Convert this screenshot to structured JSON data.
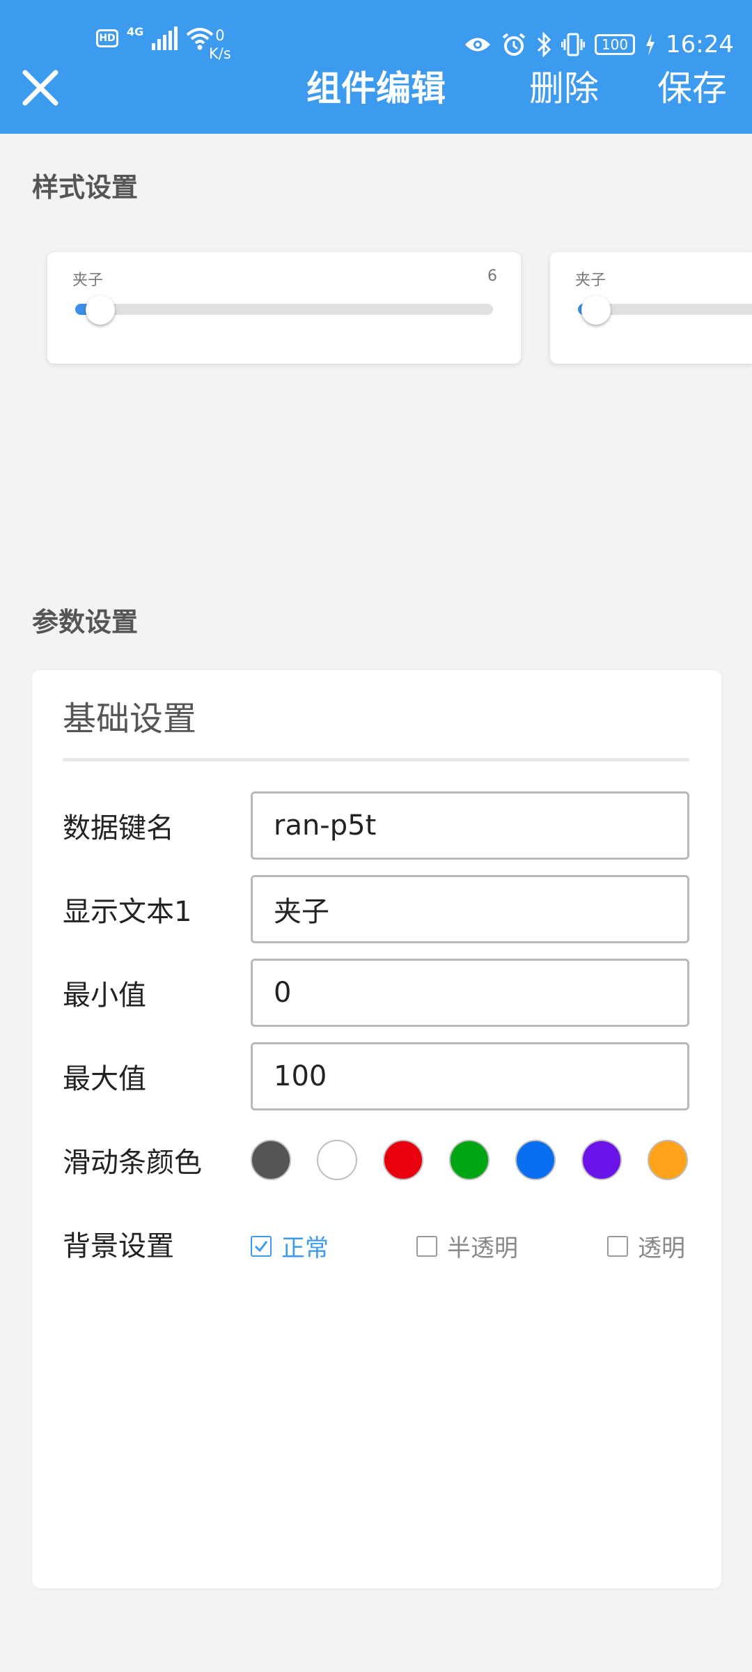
{
  "status_bar": {
    "hd": "HD",
    "network": "4G",
    "speed_value": "0",
    "speed_unit": "K/s",
    "battery": "100",
    "time": "16:24"
  },
  "header": {
    "title": "组件编辑",
    "delete_label": "删除",
    "save_label": "保存",
    "bg_color": "#3c9aef"
  },
  "style_section": {
    "title": "样式设置",
    "sliders": [
      {
        "label": "夹子",
        "value": "6",
        "level": 0.06
      },
      {
        "label": "夹子",
        "value": "",
        "level": 0.06
      }
    ]
  },
  "param_section": {
    "title": "参数设置",
    "card_title": "基础设置",
    "fields": [
      {
        "label": "数据键名",
        "value": "ran-p5t"
      },
      {
        "label": "显示文本1",
        "value": "夹子"
      },
      {
        "label": "最小值",
        "value": "0"
      },
      {
        "label": "最大值",
        "value": "100"
      }
    ],
    "color_label": "滑动条颜色",
    "colors": [
      "#555555",
      "#ffffff",
      "#e8000e",
      "#00a513",
      "#0a6ef0",
      "#6b12e8",
      "#ffa31a"
    ],
    "background_label": "背景设置",
    "background_options": [
      {
        "label": "正常",
        "checked": true
      },
      {
        "label": "半透明",
        "checked": false
      },
      {
        "label": "透明",
        "checked": false
      }
    ]
  }
}
